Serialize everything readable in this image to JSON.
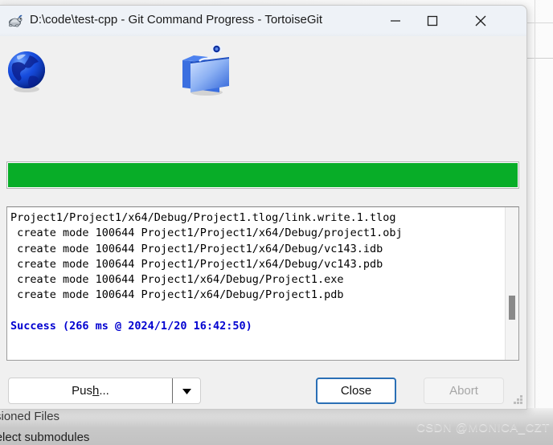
{
  "window": {
    "title": "D:\\code\\test-cpp - Git Command Progress - TortoiseGit",
    "icon": "tortoise-icon",
    "controls": {
      "minimize": "—",
      "maximize": "☐",
      "close": "✕"
    }
  },
  "animation": {
    "source_icon": "globe-icon",
    "target_icon": "folder-icon"
  },
  "progress": {
    "percent": 100,
    "color": "#08ad28"
  },
  "log": {
    "lines": [
      "Project1/Project1/x64/Debug/Project1.tlog/link.write.1.tlog",
      " create mode 100644 Project1/Project1/x64/Debug/project1.obj",
      " create mode 100644 Project1/Project1/x64/Debug/vc143.idb",
      " create mode 100644 Project1/Project1/x64/Debug/vc143.pdb",
      " create mode 100644 Project1/x64/Debug/Project1.exe",
      " create mode 100644 Project1/x64/Debug/Project1.pdb",
      "",
      ""
    ],
    "status_line": "Success (266 ms @ 2024/1/20 16:42:50)",
    "status_color": "#0000d0",
    "scrollbar": "vertical-scrollbar"
  },
  "buttons": {
    "push_label": "Push...",
    "push_accel": "h",
    "push_dropdown": "▼",
    "close_label": "Close",
    "abort_label": "Abort"
  },
  "background": {
    "text_1": "Unversioned Files",
    "text_2": "autoselect submodules",
    "watermark": "CSDN @MONICA_CZT"
  }
}
